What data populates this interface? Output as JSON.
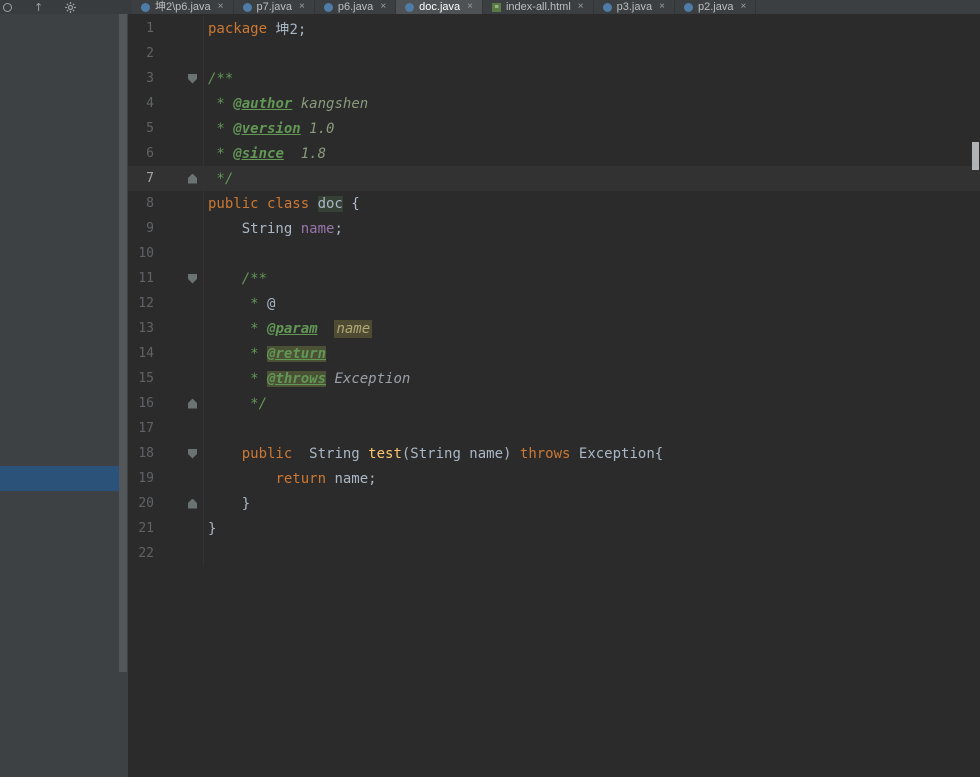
{
  "colors": {
    "editor_bg": "#2b2b2b",
    "panel_bg": "#3e4143",
    "tabbar_bg": "#3c3f41",
    "active_tab_bg": "#4e5254",
    "caret_line_bg": "#323232",
    "selection_blue": "#2b5278",
    "keyword": "#cc7832",
    "default_text": "#a9b7c6",
    "comment_green": "#629755",
    "line_number": "#606366",
    "method_yellow": "#ffc66d",
    "field_purple": "#9876aa"
  },
  "toolbar": {
    "icons": [
      "record-icon",
      "up-arrow-icon",
      "gear-icon"
    ],
    "up_arrow_glyph": "↑"
  },
  "tab_close_glyph": "×",
  "tabs": [
    {
      "label": "坤2\\p6.java",
      "icon": "java",
      "active": false
    },
    {
      "label": "p7.java",
      "icon": "java",
      "active": false
    },
    {
      "label": "p6.java",
      "icon": "java",
      "active": false
    },
    {
      "label": "doc.java",
      "icon": "java",
      "active": true
    },
    {
      "label": "index-all.html",
      "icon": "html",
      "active": false
    },
    {
      "label": "p3.java",
      "icon": "java",
      "active": false
    },
    {
      "label": "p2.java",
      "icon": "java",
      "active": false
    }
  ],
  "editor": {
    "file_name": "doc.java",
    "lines": [
      {
        "n": 1,
        "segs": [
          {
            "t": "package",
            "c": "kw"
          },
          {
            "t": " 坤2;",
            "c": "def"
          }
        ]
      },
      {
        "n": 2,
        "segs": []
      },
      {
        "n": 3,
        "fold": "start",
        "segs": [
          {
            "t": "/**",
            "c": "cmt"
          }
        ]
      },
      {
        "n": 4,
        "segs": [
          {
            "t": " * ",
            "c": "cmt"
          },
          {
            "t": "@author",
            "c": "tag"
          },
          {
            "t": " kangshen",
            "c": "docval"
          }
        ]
      },
      {
        "n": 5,
        "segs": [
          {
            "t": " * ",
            "c": "cmt"
          },
          {
            "t": "@version",
            "c": "tag"
          },
          {
            "t": " 1.0",
            "c": "docval"
          }
        ]
      },
      {
        "n": 6,
        "segs": [
          {
            "t": " * ",
            "c": "cmt"
          },
          {
            "t": "@since",
            "c": "tag"
          },
          {
            "t": "  1.8",
            "c": "docval"
          }
        ]
      },
      {
        "n": 7,
        "fold": "end",
        "caret": true,
        "segs": [
          {
            "t": " */",
            "c": "cmt"
          }
        ]
      },
      {
        "n": 8,
        "segs": [
          {
            "t": "public class ",
            "c": "kw"
          },
          {
            "t": "doc",
            "c": "def hl-ident"
          },
          {
            "t": " {",
            "c": "def"
          }
        ]
      },
      {
        "n": 9,
        "segs": [
          {
            "t": "    String ",
            "c": "def"
          },
          {
            "t": "name",
            "c": "field"
          },
          {
            "t": ";",
            "c": "def"
          }
        ]
      },
      {
        "n": 10,
        "segs": []
      },
      {
        "n": 11,
        "fold": "start",
        "segs": [
          {
            "t": "    /**",
            "c": "cmt"
          }
        ]
      },
      {
        "n": 12,
        "segs": [
          {
            "t": "     * ",
            "c": "cmt"
          },
          {
            "t": "@",
            "c": "def"
          }
        ]
      },
      {
        "n": 13,
        "segs": [
          {
            "t": "     * ",
            "c": "cmt"
          },
          {
            "t": "@param",
            "c": "tag"
          },
          {
            "t": "  ",
            "c": "cmt"
          },
          {
            "t": "name",
            "c": "hl-param"
          }
        ]
      },
      {
        "n": 14,
        "segs": [
          {
            "t": "     * ",
            "c": "cmt"
          },
          {
            "t": "@return",
            "c": "tag hl-tag"
          }
        ]
      },
      {
        "n": 15,
        "segs": [
          {
            "t": "     * ",
            "c": "cmt"
          },
          {
            "t": "@throws",
            "c": "tag hl-tag"
          },
          {
            "t": " Exception",
            "c": "docref"
          }
        ]
      },
      {
        "n": 16,
        "fold": "end",
        "segs": [
          {
            "t": "     */",
            "c": "cmt"
          }
        ]
      },
      {
        "n": 17,
        "segs": []
      },
      {
        "n": 18,
        "fold": "start",
        "segs": [
          {
            "t": "    ",
            "c": "def"
          },
          {
            "t": "public",
            "c": "kw"
          },
          {
            "t": "  String ",
            "c": "def"
          },
          {
            "t": "test",
            "c": "method"
          },
          {
            "t": "(String name) ",
            "c": "def"
          },
          {
            "t": "throws",
            "c": "kw"
          },
          {
            "t": " Exception{",
            "c": "def"
          }
        ]
      },
      {
        "n": 19,
        "segs": [
          {
            "t": "        ",
            "c": "def"
          },
          {
            "t": "return",
            "c": "kw"
          },
          {
            "t": " name;",
            "c": "def"
          }
        ]
      },
      {
        "n": 20,
        "fold": "end",
        "segs": [
          {
            "t": "    }",
            "c": "def"
          }
        ]
      },
      {
        "n": 21,
        "segs": [
          {
            "t": "}",
            "c": "def"
          }
        ]
      },
      {
        "n": 22,
        "segs": []
      }
    ]
  }
}
